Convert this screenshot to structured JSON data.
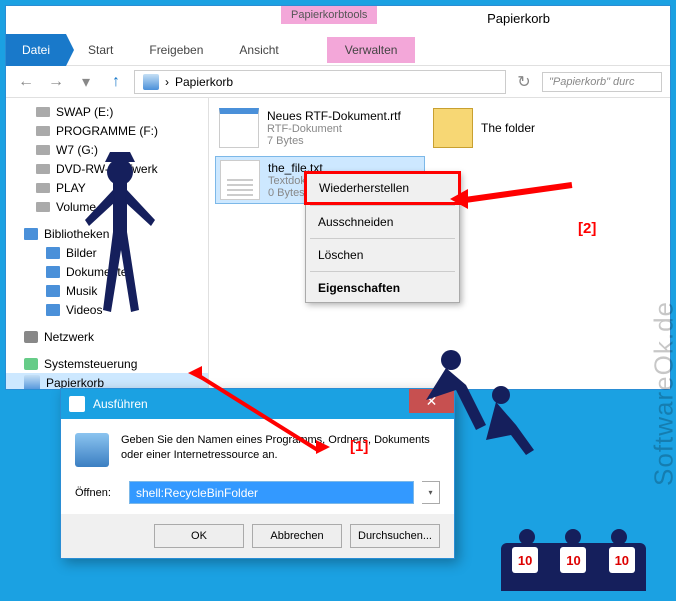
{
  "explorer": {
    "ribbon_hint": "Papierkorbtools",
    "title": "Papierkorb",
    "tabs": {
      "file": "Datei",
      "start": "Start",
      "share": "Freigeben",
      "view": "Ansicht",
      "manage": "Verwalten"
    },
    "path": "Papierkorb",
    "search_placeholder": "\"Papierkorb\" durc",
    "nav": [
      {
        "label": "SWAP (E:)",
        "type": "drive"
      },
      {
        "label": "PROGRAMME (F:)",
        "type": "drive"
      },
      {
        "label": "W7 (G:)",
        "type": "drive"
      },
      {
        "label": "DVD-RW-Laufwerk",
        "type": "drive"
      },
      {
        "label": "PLAY",
        "type": "drive"
      },
      {
        "label": "Volume",
        "type": "drive"
      },
      {
        "label": "Bibliotheken",
        "type": "lib_root"
      },
      {
        "label": "Bilder",
        "type": "lib"
      },
      {
        "label": "Dokumente",
        "type": "lib"
      },
      {
        "label": "Musik",
        "type": "lib"
      },
      {
        "label": "Videos",
        "type": "lib"
      },
      {
        "label": "Netzwerk",
        "type": "net"
      },
      {
        "label": "Systemsteuerung",
        "type": "sys"
      },
      {
        "label": "Papierkorb",
        "type": "bin",
        "selected": true
      }
    ],
    "files": [
      {
        "name": "Neues RTF-Dokument.rtf",
        "type": "RTF-Dokument",
        "size": "7 Bytes",
        "ico": "rtf"
      },
      {
        "name": "The folder",
        "type": "",
        "size": "",
        "ico": "folder"
      },
      {
        "name": "the_file.txt",
        "type": "Textdokument",
        "size": "0 Bytes",
        "ico": "txt",
        "selected": true
      }
    ]
  },
  "context_menu": {
    "restore": "Wiederherstellen",
    "cut": "Ausschneiden",
    "delete": "Löschen",
    "properties": "Eigenschaften"
  },
  "run_dialog": {
    "title": "Ausführen",
    "description": "Geben Sie den Namen eines Programms, Ordners, Dokuments oder einer Internetressource an.",
    "open_label": "Öffnen:",
    "value": "shell:RecycleBinFolder",
    "ok": "OK",
    "cancel": "Abbrechen",
    "browse": "Durchsuchen..."
  },
  "annotations": {
    "a1": "[1]",
    "a2": "[2]"
  },
  "watermark": "SoftwareOk.de",
  "scores": [
    "10",
    "10",
    "10"
  ]
}
